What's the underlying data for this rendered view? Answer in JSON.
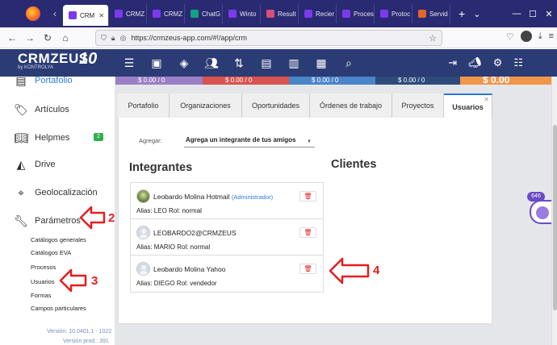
{
  "browser": {
    "tabs": [
      {
        "label": "CRM",
        "color": "#7c3aed",
        "active": true
      },
      {
        "label": "CRMZ",
        "color": "#7c3aed"
      },
      {
        "label": "CRMZ",
        "color": "#7c3aed"
      },
      {
        "label": "ChatG",
        "color": "#10a37f"
      },
      {
        "label": "Winto",
        "color": "#7c3aed"
      },
      {
        "label": "Result",
        "color": "#d94f7a"
      },
      {
        "label": "Recier",
        "color": "#7c3aed"
      },
      {
        "label": "Proces",
        "color": "#7c3aed"
      },
      {
        "label": "Protoc",
        "color": "#7c3aed"
      },
      {
        "label": "Servid",
        "color": "#e0662a"
      }
    ],
    "url": "https://crmzeus-app.com/#!/app/crm",
    "profile_initial": "Z"
  },
  "app": {
    "brand": "CRMZEUS",
    "brand_sub": "by KONTROLYA",
    "ten": "10"
  },
  "stats": [
    {
      "value": "$ 0.00 / 0",
      "color": "#9b7fc4"
    },
    {
      "value": "$ 0.00 / 0",
      "color": "#d9544f"
    },
    {
      "value": "$ 0.00 / 0",
      "color": "#4a84c9"
    },
    {
      "value": "$ 0.00 / 0",
      "color": "#2d4b7a"
    },
    {
      "value": "$ 0.00",
      "color": "#f0964a"
    }
  ],
  "sidebar": {
    "items": [
      {
        "label": "Portafolio",
        "icon": "portfolio-icon"
      },
      {
        "label": "Artículos",
        "icon": "tag-icon"
      },
      {
        "label": "Helpmes",
        "icon": "book-icon",
        "badge": "2"
      },
      {
        "label": "Drive",
        "icon": "drive-icon"
      },
      {
        "label": "Geolocalización",
        "icon": "map-pin-icon"
      },
      {
        "label": "Parámetros",
        "icon": "wrench-icon"
      }
    ],
    "sub_items": [
      "Catálogos generales",
      "Catálogos EVA",
      "Procesos",
      "Usuarios",
      "Formas",
      "Campos particulares"
    ],
    "version": "Versión: 10.0401.1 - 1022",
    "version2": "Versión prod.: 391"
  },
  "main": {
    "tabs": [
      {
        "label": "Portafolio"
      },
      {
        "label": "Organizaciones"
      },
      {
        "label": "Oportunidades"
      },
      {
        "label": "Órdenes de trabajo"
      },
      {
        "label": "Proyectos"
      },
      {
        "label": "Usuarios",
        "active": true
      }
    ],
    "agregar_label": "Agregar:",
    "agregar_value": "Agrega un integrante de tus amigos",
    "integrantes_title": "Integrantes",
    "clientes_title": "Clientes",
    "members": [
      {
        "name": "Leobardo Molina Hotmail",
        "role": "(Administrador)",
        "alias": "Alias: LEO Rol: normal",
        "photo": true
      },
      {
        "name": "LEOBARDO2@CRMZEUS",
        "role": "",
        "alias": "Alias: MARIO Rol: normal",
        "photo": false
      },
      {
        "name": "Leobardo Molina Yahoo",
        "role": "",
        "alias": "Alias: DIEGO Rol: vendedor",
        "photo": false
      }
    ]
  },
  "widget": {
    "badge": "646"
  },
  "annotations": {
    "two": "2",
    "three": "3",
    "four": "4"
  }
}
